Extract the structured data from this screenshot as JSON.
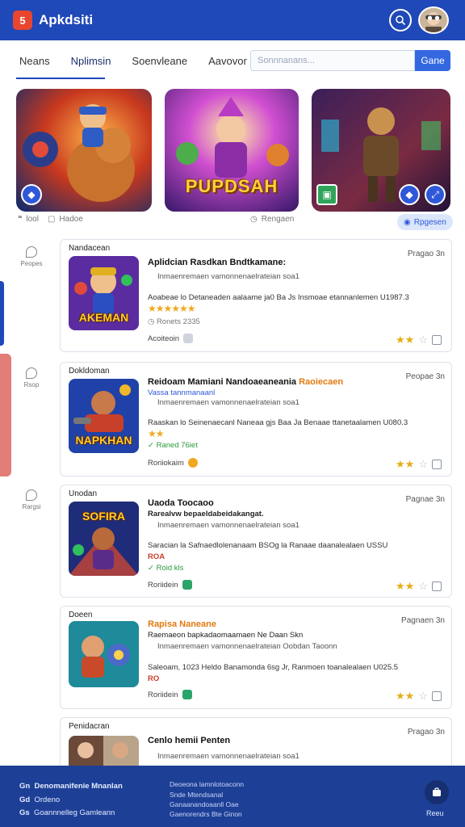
{
  "header": {
    "logo_glyph": "5",
    "brand": "Apkdsiti",
    "search_icon": "search-icon",
    "avatar_icon": "avatar"
  },
  "tabs": [
    {
      "label": "Neans"
    },
    {
      "label": "Nplimsin"
    },
    {
      "label": "Soenvleane"
    },
    {
      "label": "Aavovor"
    }
  ],
  "search": {
    "placeholder": "Sonnnanans...",
    "button": "Gane"
  },
  "featured": [
    {
      "title": ""
    },
    {
      "title": "PUPDSAH"
    },
    {
      "title": ""
    }
  ],
  "featured_meta": {
    "left_icon_text": "lool",
    "left_label": "Hadoe",
    "center_label": "Rengaen",
    "right_pill": "Rpgesen"
  },
  "rail": [
    {
      "label": "Peopes"
    },
    {
      "label": "Rsop"
    },
    {
      "label": "Rargsi"
    }
  ],
  "cards": [
    {
      "category": "Nandacean",
      "page": "Pragao 3n",
      "thumb_text": "AKEMAN",
      "title": "Aplidcian Rasdkan Bndtkamane:",
      "title_highlight": "",
      "subtitle": "",
      "desc": "Inmaenremaen vamonnenaelrateian soa1",
      "line1": "Aoabeae lo Detaneaden aalaame ja0 Ba Js Insmoae etannanlemen U1987.3",
      "line2_prefix": "",
      "line2_stars": "★★★★★★",
      "line2_suffix": "",
      "extra": "Ronets 2335",
      "action": "Acoiteoin"
    },
    {
      "category": "Dokldoman",
      "page": "Peopae 3n",
      "thumb_text": "NAPKHAN",
      "title": "Reidoam Mamiani Nandoaeaneania",
      "title_highlight": "Raoiecaen",
      "subtitle": "Vassa tannmanaanl",
      "desc": "Inmaenremaen vamonnenaelrateian soa1",
      "line1": "Raaskan lo Seinenaecanl Naneaa gjs Baa Ja Benaae ttanetaalamen U080.3",
      "line2_prefix": "",
      "line2_stars": "★★",
      "line2_suffix": "",
      "extra": "Raned 76iet",
      "action": "Roriiokaim"
    },
    {
      "category": "Unodan",
      "page": "Pagnae 3n",
      "thumb_text": "SOFIRA",
      "title": "Uaoda Toocaoo",
      "title_highlight": "",
      "subtitle": "Rarealvw bepaeldabeidakangat.",
      "desc": "Inmaenremaen vamonnenaelrateian soa1",
      "line1": "Saracian la Safnaedlolenanaam BSOg la Ranaae daanalealaen USSU",
      "line2_prefix": "",
      "line2_stars": "",
      "line2_suffix": "ROA",
      "extra": "Roid kls",
      "action": "Roriidein"
    },
    {
      "category": "Doeen",
      "page": "Pagnaen 3n",
      "thumb_text": "",
      "title": "",
      "title_highlight": "Rapisa Naneane",
      "subtitle": "Raemaeon bapkadaomaamaen Ne Daan Skn",
      "desc": "Inmaenremaen vamonnenaelrateian Oobdan Taoonn",
      "line1": "Saleoam, 1023 Heldo Banamonda 6sg Jr, Ranmoen toanalealaen U025.5",
      "line2_prefix": "RO",
      "line2_stars": "",
      "line2_suffix": "",
      "extra": "",
      "action": "Roriidein"
    },
    {
      "category": "Penidacran",
      "page": "Pragao 3n",
      "thumb_text": "",
      "title": "Cenlo hemii Penten",
      "title_highlight": "",
      "subtitle": "",
      "desc": "Inmaenremaen vamonnenaelrateian soa1",
      "line1": "",
      "line2_prefix": "",
      "line2_stars": "",
      "line2_suffix": "",
      "extra": "",
      "action": ""
    }
  ],
  "footer": {
    "rows": [
      {
        "icon": "Gn",
        "text": "Denomanifenie Mnanlan"
      },
      {
        "icon": "Gd",
        "text": "Ordeno"
      },
      {
        "icon": "Gs",
        "text": "Goannnelleg Gamleann"
      }
    ],
    "links": [
      "Deoeona lamnlotoaconn",
      "Snde Mtendsanal",
      "Ganaanandoaanll Oae",
      "Gaenorendrs Bte Ginon"
    ],
    "button_label": "Reeu"
  }
}
